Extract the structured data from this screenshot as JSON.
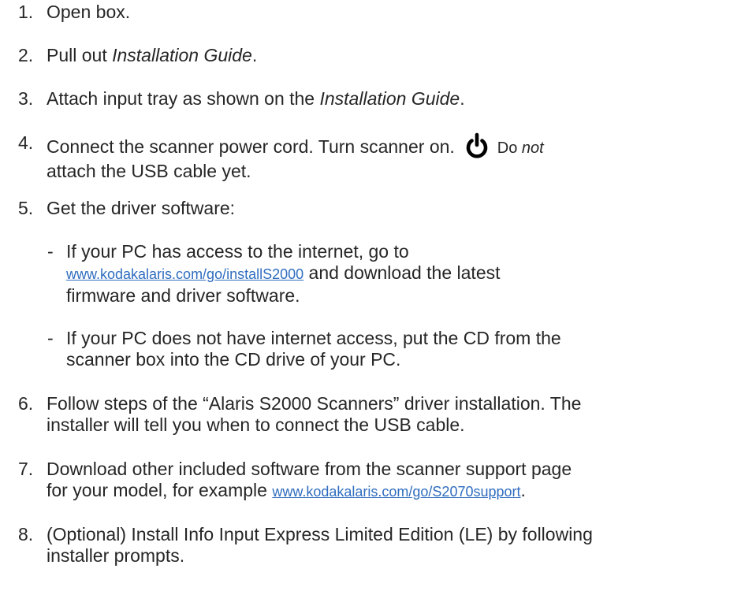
{
  "steps": [
    {
      "num": "1.",
      "text": "Open box."
    },
    {
      "num": "2.",
      "pre": "Pull out ",
      "em": "Installation Guide",
      "post": "."
    },
    {
      "num": "3.",
      "pre": "Attach input tray as shown on the ",
      "em": "Installation Guide",
      "post": "."
    },
    {
      "num": "4.",
      "pre": "Connect the scanner power cord. Turn scanner on.",
      "do": "Do ",
      "em": "not",
      "line2": "attach the USB cable yet."
    },
    {
      "num": "5.",
      "text": "Get the driver software:"
    },
    {
      "num": "6.",
      "line1": "Follow steps of the “Alaris S2000 Scanners” driver installation. The",
      "line2": "installer will tell you when to connect the USB cable."
    },
    {
      "num": "7.",
      "line1": "Download other included software from the scanner support page",
      "pre2": "for your model, for example ",
      "link": "www.kodakalaris.com/go/S2070support",
      "post2": "."
    },
    {
      "num": "8.",
      "line1": "(Optional) Install Info Input Express Limited Edition (LE) by following",
      "line2": "installer prompts."
    }
  ],
  "substeps": [
    {
      "dash": "-",
      "line1": "If your PC has access to the internet, go to",
      "link": "www.kodakalaris.com/go/installS2000",
      "post": " and download the latest",
      "line3": "firmware and driver software."
    },
    {
      "dash": "-",
      "line1": "If your PC does not have internet access, put the CD from the",
      "line2": "scanner box into the CD drive of your PC."
    }
  ],
  "icons": {
    "power": "power-icon"
  }
}
